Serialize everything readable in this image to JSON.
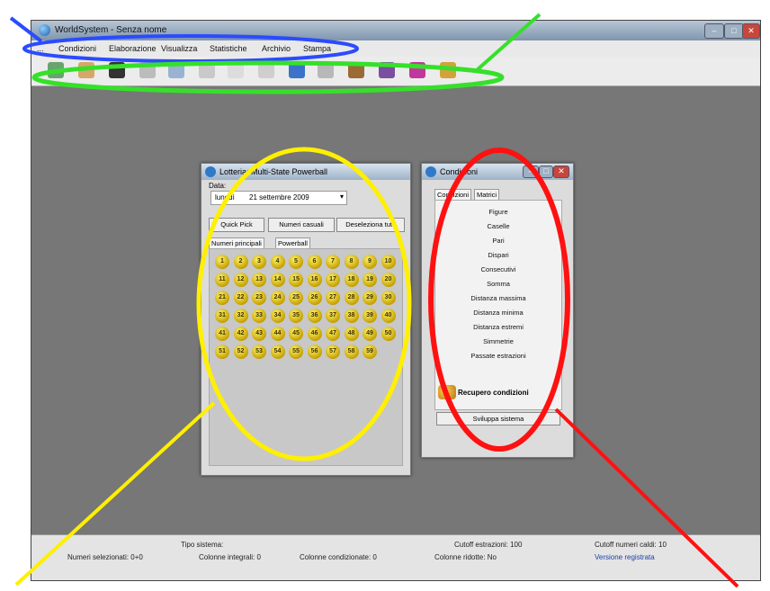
{
  "window": {
    "title": "WorldSystem - Senza nome"
  },
  "menu": {
    "items": [
      "...",
      "Condizioni",
      "Elaborazione",
      "Visualizza",
      "Statistiche",
      "Archivio",
      "Stampa"
    ]
  },
  "lottery_window": {
    "title": "Lotteria: Multi-State Powerball",
    "date_label": "Data:",
    "date_day": "lunedì",
    "date_value": "21 settembre 2009",
    "buttons": {
      "quick_pick": "Quick Pick",
      "random": "Numeri casuali",
      "deselect": "Deseleziona tutti"
    },
    "tabs": {
      "main": "Numeri principali",
      "powerball": "Powerball"
    },
    "balls": [
      "1",
      "2",
      "3",
      "4",
      "5",
      "6",
      "7",
      "8",
      "9",
      "10",
      "11",
      "12",
      "13",
      "14",
      "15",
      "16",
      "17",
      "18",
      "19",
      "20",
      "21",
      "22",
      "23",
      "24",
      "25",
      "26",
      "27",
      "28",
      "29",
      "30",
      "31",
      "32",
      "33",
      "34",
      "35",
      "36",
      "37",
      "38",
      "39",
      "40",
      "41",
      "42",
      "43",
      "44",
      "45",
      "46",
      "47",
      "48",
      "49",
      "50",
      "51",
      "52",
      "53",
      "54",
      "55",
      "56",
      "57",
      "58",
      "59"
    ]
  },
  "conditions_window": {
    "title": "Condizioni",
    "tabs": {
      "conditions": "Condizioni",
      "matrices": "Matrici"
    },
    "items": [
      "Figure",
      "Caselle",
      "Pari",
      "Dispari",
      "Consecutivi",
      "Somma",
      "Distanza massima",
      "Distanza minima",
      "Distanza estremi",
      "Simmetrie",
      "Passate estrazioni"
    ],
    "recover": "Recupero condizioni",
    "develop": "Sviluppa sistema"
  },
  "statusbar": {
    "system_type": "Tipo sistema:",
    "cutoff_draws": "Cutoff estrazioni: 100",
    "cutoff_hot": "Cutoff numeri caldi: 10",
    "selected": "Numeri selezionati: 0+0",
    "integral": "Colonne integrali: 0",
    "conditioned": "Colonne condizionate: 0",
    "reduced": "Colonne ridotte: No",
    "registered": "Versione registrata"
  },
  "colors": {
    "blue": "#2b4bff",
    "green": "#36e02a",
    "yellow": "#ffef00",
    "red": "#ff1111",
    "ball": "#d9b400"
  },
  "icons": [
    "lottery-icon",
    "open-icon",
    "save-icon",
    "archive-icon",
    "notes-icon",
    "chart-icon",
    "bottle-icon",
    "bowl-icon",
    "search-icon",
    "pie-icon",
    "box-icon",
    "book-icon",
    "matrix-icon",
    "edit-icon"
  ]
}
